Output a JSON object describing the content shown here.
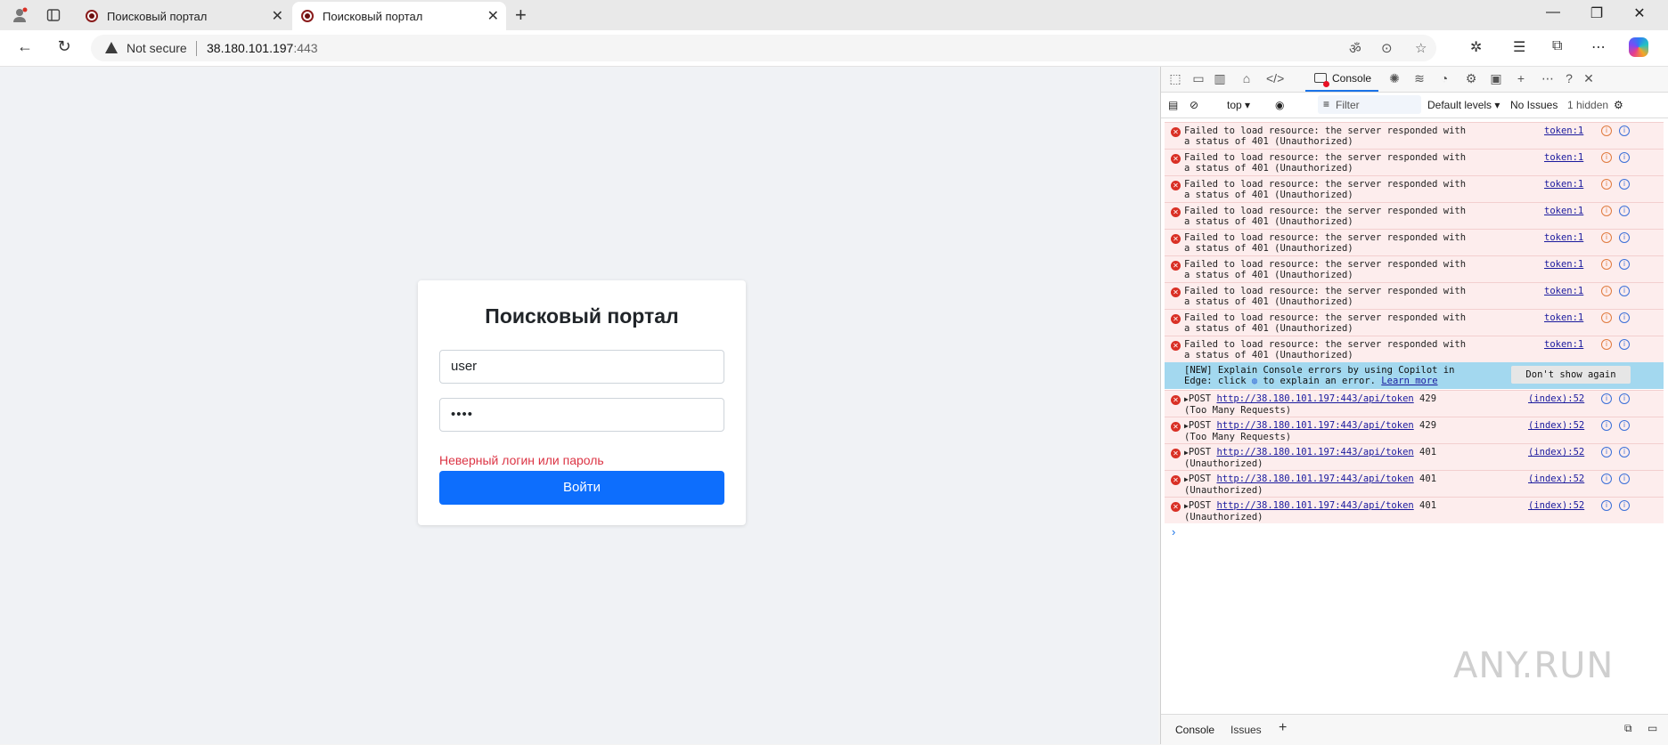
{
  "browser": {
    "tabs": [
      {
        "title": "Поисковый портал",
        "active": false
      },
      {
        "title": "Поисковый портал",
        "active": true
      }
    ],
    "address": {
      "security_label": "Not secure",
      "host": "38.180.101.197",
      "port": ":443"
    }
  },
  "page": {
    "title": "Поисковый портал",
    "username_value": "user",
    "password_value": "••••",
    "error_text": "Неверный логин или пароль",
    "submit_label": "Войти"
  },
  "devtools": {
    "active_tab": "Console",
    "context": "top",
    "filter_placeholder": "Filter",
    "levels": "Default levels",
    "issues": "No Issues",
    "hidden": "1 hidden",
    "resource_errors": [
      {
        "text": "Failed to load resource: the server responded with a status of 401 (Unauthorized)",
        "source": "token:1"
      },
      {
        "text": "Failed to load resource: the server responded with a status of 401 (Unauthorized)",
        "source": "token:1"
      },
      {
        "text": "Failed to load resource: the server responded with a status of 401 (Unauthorized)",
        "source": "token:1"
      },
      {
        "text": "Failed to load resource: the server responded with a status of 401 (Unauthorized)",
        "source": "token:1"
      },
      {
        "text": "Failed to load resource: the server responded with a status of 401 (Unauthorized)",
        "source": "token:1"
      },
      {
        "text": "Failed to load resource: the server responded with a status of 401 (Unauthorized)",
        "source": "token:1"
      },
      {
        "text": "Failed to load resource: the server responded with a status of 401 (Unauthorized)",
        "source": "token:1"
      },
      {
        "text": "Failed to load resource: the server responded with a status of 401 (Unauthorized)",
        "source": "token:1"
      },
      {
        "text": "Failed to load resource: the server responded with a status of 401 (Unauthorized)",
        "source": "token:1"
      }
    ],
    "copilot_info": {
      "prefix": "[NEW] Explain Console errors by using Copilot in Edge: click",
      "suffix": "to explain an error.",
      "link": "Learn more",
      "button": "Don't show again"
    },
    "post_errors": [
      {
        "method": "POST",
        "url": "http://38.180.101.197:443/api/token",
        "status": "429 (Too Many Requests)",
        "source": "(index):52"
      },
      {
        "method": "POST",
        "url": "http://38.180.101.197:443/api/token",
        "status": "429 (Too Many Requests)",
        "source": "(index):52"
      },
      {
        "method": "POST",
        "url": "http://38.180.101.197:443/api/token",
        "status": "401 (Unauthorized)",
        "source": "(index):52"
      },
      {
        "method": "POST",
        "url": "http://38.180.101.197:443/api/token",
        "status": "401 (Unauthorized)",
        "source": "(index):52"
      },
      {
        "method": "POST",
        "url": "http://38.180.101.197:443/api/token",
        "status": "401 (Unauthorized)",
        "source": "(index):52"
      }
    ],
    "drawer_tabs": [
      "Console",
      "Issues"
    ]
  },
  "watermark": "ANY.RUN"
}
